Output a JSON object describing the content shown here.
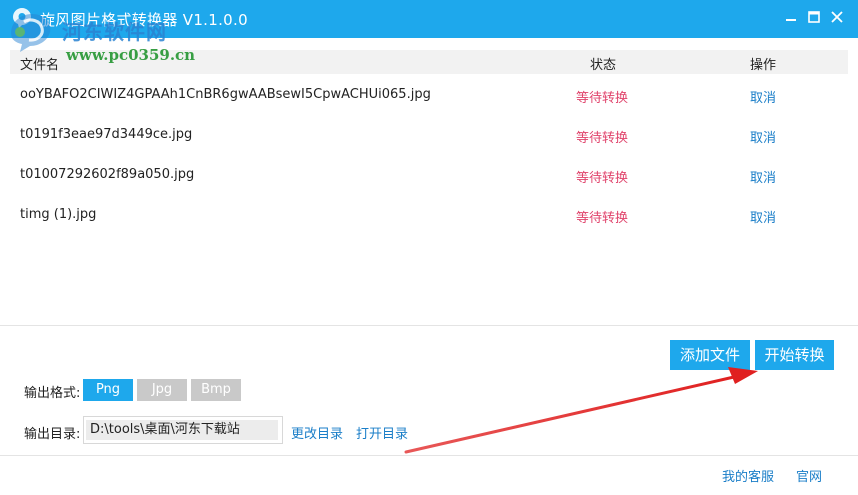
{
  "titlebar": {
    "title": "旋风图片格式转换器 V1.1.0.0",
    "buttons": [
      "minimize-icon",
      "maximize-icon",
      "close-icon"
    ]
  },
  "watermark": {
    "site_name": "河东软件网",
    "url": "www.pc0359.cn"
  },
  "table": {
    "headers": {
      "name": "文件名",
      "status": "状态",
      "operation": "操作"
    },
    "rows": [
      {
        "name": "ooYBAFO2CIWIZ4GPAAh1CnBR6gwAABsewI5CpwACHUi065.jpg",
        "status": "等待转换",
        "action": "取消"
      },
      {
        "name": "t0191f3eae97d3449ce.jpg",
        "status": "等待转换",
        "action": "取消"
      },
      {
        "name": "t01007292602f89a050.jpg",
        "status": "等待转换",
        "action": "取消"
      },
      {
        "name": "timg (1).jpg",
        "status": "等待转换",
        "action": "取消"
      }
    ]
  },
  "actions": {
    "add_label": "添加文件",
    "start_label": "开始转换"
  },
  "output": {
    "format_label": "输出格式:",
    "formats": [
      "Png",
      "Jpg",
      "Bmp"
    ],
    "selected_format": "Png",
    "dir_label": "输出目录:",
    "dir_value": "D:\\tools\\桌面\\河东下载站",
    "change_dir": "更改目录",
    "open_dir": "打开目录"
  },
  "footer": {
    "service": "我的客服",
    "website": "官网"
  },
  "colors": {
    "accent": "#1ea8ec",
    "status_waiting": "#e0436b",
    "link": "#1a7ec8",
    "format_inactive": "#c9c9c9",
    "annotation_arrow": "#e02020"
  }
}
